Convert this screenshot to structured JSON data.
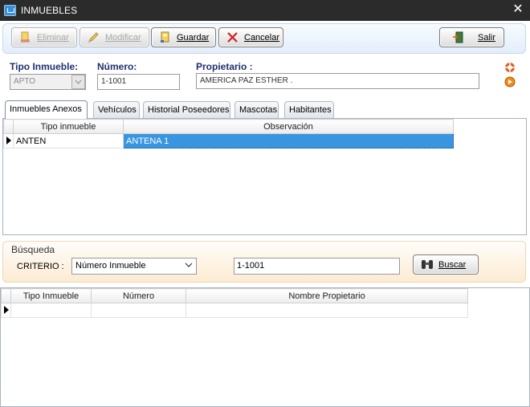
{
  "window": {
    "title": "INMUEBLES",
    "close_glyph": "✕"
  },
  "toolbar": {
    "eliminar": "Eliminar",
    "modificar": "Modificar",
    "guardar": "Guardar",
    "cancelar": "Cancelar",
    "salir": "Salir"
  },
  "header": {
    "tipo_label": "Tipo Inmueble:",
    "tipo_value": "APTO",
    "numero_label": "Número:",
    "numero_value": "1-1001",
    "propietario_label": "Propietario :",
    "propietario_value": "AMERICA PAZ ESTHER  ."
  },
  "tabs": [
    "Inmuebles Anexos",
    "Vehículos",
    "Historial Poseedores",
    "Mascotas",
    "Habitantes"
  ],
  "anexos": {
    "columns": [
      "Tipo inmueble",
      "Observación"
    ],
    "rows": [
      {
        "tipo": "ANTEN",
        "observacion": "ANTENA 1"
      }
    ]
  },
  "busqueda": {
    "title": "Búsqueda",
    "criterio_label": "CRITERIO :",
    "criterio_value": "Número Inmueble",
    "search_value": "1-1001",
    "buscar_label": "Buscar"
  },
  "resultados": {
    "columns": [
      "Tipo Inmueble",
      "Número",
      "Nombre Propietario"
    ]
  },
  "colors": {
    "selection": "#3a95e0",
    "titlebar": "#2b2b2b",
    "label": "#1f2f6f"
  }
}
